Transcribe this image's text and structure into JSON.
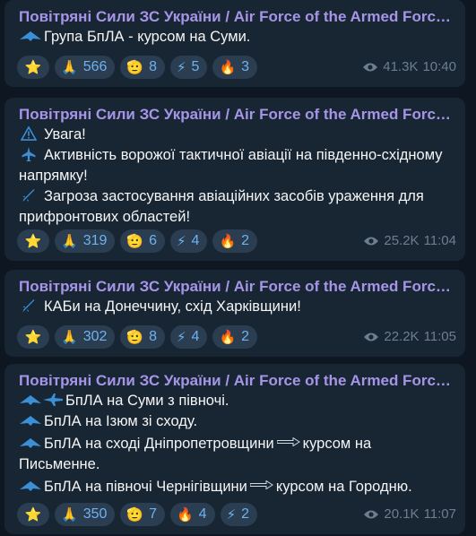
{
  "messages": [
    {
      "sender": "Повітряні Сили ЗС України / Air Force of the Armed Forces of Ukraine",
      "lines": [
        "Група БпЛА  - курсом на Суми."
      ],
      "reactions": [
        {
          "emoji": "⭐",
          "count": ""
        },
        {
          "emoji": "🙏",
          "count": "566"
        },
        {
          "emoji": "🫡",
          "count": "8"
        },
        {
          "emoji": "⚡",
          "count": "5"
        },
        {
          "emoji": "🔥",
          "count": "3"
        }
      ],
      "views": "41.3K",
      "time": "10:40"
    },
    {
      "sender": "Повітряні Сили ЗС України / Air Force of the Armed Forces of Ukraine",
      "lines": [
        "Увага!",
        "Активність ворожої тактичної авіації  на південно-східному",
        "напрямку!",
        "Загроза застосування авіаційних засобів ураження для",
        "прифронтових областей!"
      ],
      "reactions": [
        {
          "emoji": "⭐",
          "count": ""
        },
        {
          "emoji": "🙏",
          "count": "319"
        },
        {
          "emoji": "🫡",
          "count": "6"
        },
        {
          "emoji": "⚡",
          "count": "4"
        },
        {
          "emoji": "🔥",
          "count": "2"
        }
      ],
      "views": "25.2K",
      "time": "11:04"
    },
    {
      "sender": "Повітряні Сили ЗС України / Air Force of the Armed Forces of Ukraine",
      "lines": [
        "КАБи на Донеччину, схід Харківщини!"
      ],
      "reactions": [
        {
          "emoji": "⭐",
          "count": ""
        },
        {
          "emoji": "🙏",
          "count": "302"
        },
        {
          "emoji": "🫡",
          "count": "8"
        },
        {
          "emoji": "⚡",
          "count": "4"
        },
        {
          "emoji": "🔥",
          "count": "2"
        }
      ],
      "views": "22.2K",
      "time": "11:05"
    },
    {
      "sender": "Повітряні Сили ЗС України / Air Force of the Armed Forces of Ukraine",
      "lines": [
        "БпЛА на Суми з півночі.",
        "БпЛА на Ізюм зі сходу.",
        "БпЛА на сході Дніпропетровщини",
        "курсом на",
        "Письменне.",
        "БпЛА на півночі Чернігівщини",
        "курсом на Городню."
      ],
      "reactions": [
        {
          "emoji": "⭐",
          "count": ""
        },
        {
          "emoji": "🙏",
          "count": "350"
        },
        {
          "emoji": "🫡",
          "count": "7"
        },
        {
          "emoji": "🔥",
          "count": "4"
        },
        {
          "emoji": "⚡",
          "count": "2"
        }
      ],
      "views": "20.1K",
      "time": "11:07"
    }
  ],
  "colors": {
    "background": "#0e1621",
    "bubble": "#182533",
    "sender": "#a695e7",
    "reaction_bg": "#2b3d50",
    "reaction_text": "#6fb2ef",
    "meta_text": "#6d7f8f",
    "icon_blue": "#3a8fd6"
  },
  "icons": [
    "drone-icon",
    "warning-triangle-icon",
    "jet-icon",
    "missile-icon",
    "arrow-right-icon",
    "eye-icon"
  ]
}
